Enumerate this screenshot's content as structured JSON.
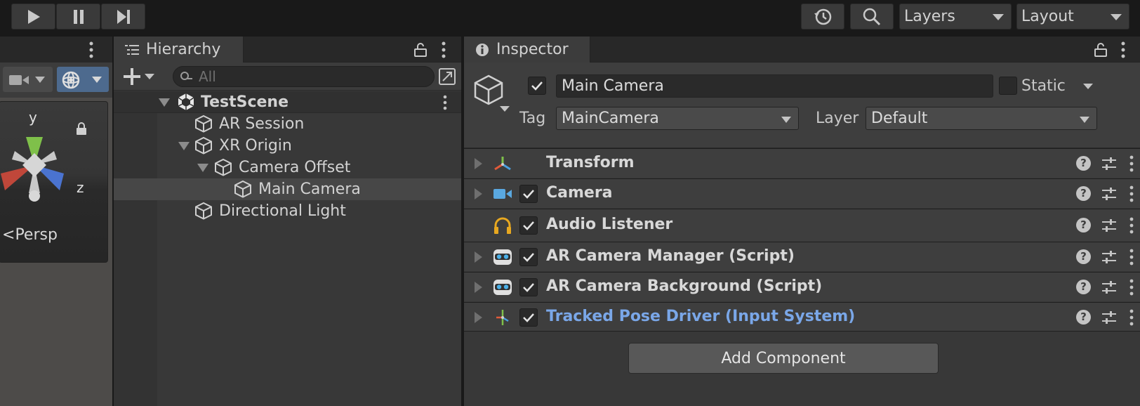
{
  "toolbar": {
    "layers_label": "Layers",
    "layout_label": "Layout"
  },
  "scene": {
    "gizmo_axis_y": "y",
    "gizmo_axis_z": "z",
    "projection_label": "Persp"
  },
  "hierarchy": {
    "tab_label": "Hierarchy",
    "search_placeholder": "All",
    "scene_name": "TestScene",
    "items": [
      {
        "label": "AR Session"
      },
      {
        "label": "XR Origin"
      },
      {
        "label": "Camera Offset"
      },
      {
        "label": "Main Camera"
      },
      {
        "label": "Directional Light"
      }
    ]
  },
  "inspector": {
    "tab_label": "Inspector",
    "object_name": "Main Camera",
    "static_label": "Static",
    "tag_label": "Tag",
    "tag_value": "MainCamera",
    "layer_label": "Layer",
    "layer_value": "Default",
    "components": [
      {
        "name": "Transform",
        "icon": "transform-icon"
      },
      {
        "name": "Camera",
        "icon": "camera-icon"
      },
      {
        "name": "Audio Listener",
        "icon": "headphones-icon"
      },
      {
        "name": "AR Camera Manager (Script)",
        "icon": "ar-script-icon"
      },
      {
        "name": "AR Camera Background (Script)",
        "icon": "ar-script-icon"
      },
      {
        "name": "Tracked Pose Driver (Input System)",
        "icon": "pose-driver-icon"
      }
    ],
    "add_component_label": "Add Component"
  },
  "colors": {
    "accent_blue": "#7aa7e8",
    "selection": "#474747",
    "panel_bg": "#383838"
  }
}
